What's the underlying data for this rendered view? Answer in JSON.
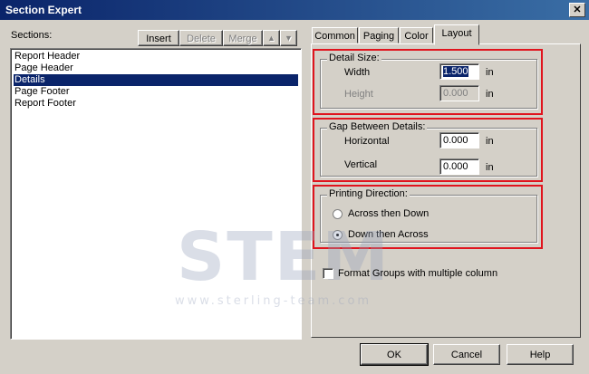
{
  "window": {
    "title": "Section Expert",
    "close_glyph": "✕"
  },
  "sections": {
    "label": "Sections:",
    "buttons": {
      "insert": "Insert",
      "delete": "Delete",
      "merge": "Merge",
      "up_glyph": "▲",
      "down_glyph": "▼"
    },
    "items": [
      "Report Header",
      "Page Header",
      "Details",
      "Page Footer",
      "Report Footer"
    ],
    "selected_index": 2
  },
  "tabs": [
    "Common",
    "Paging",
    "Color",
    "Layout"
  ],
  "active_tab": "Layout",
  "layout": {
    "detail_size": {
      "legend": "Detail Size:",
      "width_label": "Width",
      "width_value": "1.500",
      "height_label": "Height",
      "height_value": "0.000",
      "unit": "in"
    },
    "gap": {
      "legend": "Gap Between Details:",
      "horizontal_label": "Horizontal",
      "horizontal_value": "0.000",
      "vertical_label": "Vertical",
      "vertical_value": "0.000",
      "unit": "in"
    },
    "direction": {
      "legend": "Printing Direction:",
      "option1": "Across then Down",
      "option2": "Down then Across",
      "selected": "Down then Across"
    },
    "format_groups_label": "Format Groups with multiple column",
    "format_groups_checked": false
  },
  "watermark": {
    "logo": "STEM",
    "url": "www.sterling-team.com"
  },
  "footer": {
    "ok": "OK",
    "cancel": "Cancel",
    "help": "Help"
  },
  "colors": {
    "highlight": "#e0141e",
    "selection": "#0a246a",
    "face": "#d4d0c8"
  }
}
